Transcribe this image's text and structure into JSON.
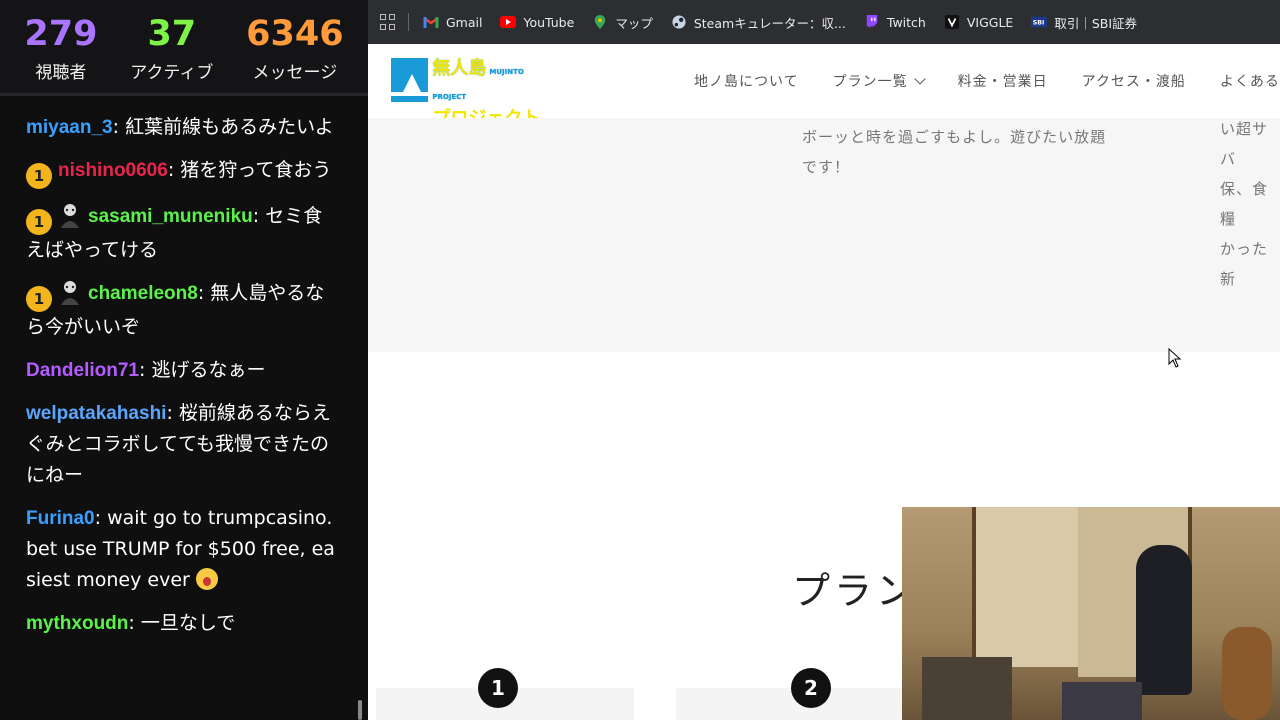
{
  "chat": {
    "stats": [
      {
        "value": "279",
        "label": "視聴者",
        "color": "#a974ff"
      },
      {
        "value": "37",
        "label": "アクティブ",
        "color": "#7ff24a"
      },
      {
        "value": "6346",
        "label": "メッセージ",
        "color": "#ff9b3a"
      }
    ],
    "messages": [
      {
        "user": "miyaan_3",
        "color": "#3aa0ff",
        "text": "紅葉前線もあるみたいよ",
        "badge": "",
        "avatar": false
      },
      {
        "user": "nishino0606",
        "color": "#e8254b",
        "text": "猪を狩って食おう",
        "badge": "1",
        "avatar": false
      },
      {
        "user": "sasami_muneniku",
        "color": "#5bf24a",
        "text": "セミ食えばやってける",
        "badge": "1",
        "avatar": true
      },
      {
        "user": "chameleon8",
        "color": "#5bf24a",
        "text": "無人島やるなら今がいいぞ",
        "badge": "1",
        "avatar": true
      },
      {
        "user": "Dandelion71",
        "color": "#b45cff",
        "text": "逃げるなぁー",
        "badge": "",
        "avatar": false
      },
      {
        "user": "welpatakahashi",
        "color": "#5aa6ff",
        "text": "桜前線あるならえぐみとコラボしてても我慢できたのにねー",
        "badge": "",
        "avatar": false
      },
      {
        "user": "Furina0",
        "color": "#3aa0ff",
        "text": "wait go to trumpcasino.bet use TRUMP for $500 free, easiest money ever",
        "badge": "",
        "avatar": false,
        "emoji": "scream-emoji"
      },
      {
        "user": "mythxoudn",
        "color": "#5bf24a",
        "text": "一旦なしで",
        "badge": "",
        "avatar": false
      }
    ]
  },
  "bookmarks": [
    {
      "label": "Gmail",
      "icon": "gmail-icon",
      "color": "#ea4335"
    },
    {
      "label": "YouTube",
      "icon": "youtube-icon",
      "color": "#ff0000"
    },
    {
      "label": "マップ",
      "icon": "maps-icon",
      "color": "#34a853"
    },
    {
      "label": "Steamキュレーター：収...",
      "icon": "steam-icon",
      "color": "#c7d5e0"
    },
    {
      "label": "Twitch",
      "icon": "twitch-icon",
      "color": "#9146ff"
    },
    {
      "label": "VIGGLE",
      "icon": "viggle-icon",
      "color": "#ffffff"
    },
    {
      "label": "取引｜SBI証券",
      "icon": "sbi-icon",
      "color": "#1d3a8a"
    }
  ],
  "site": {
    "logo": {
      "line1": "無人島",
      "tag": "MUJINTO PROJECT",
      "line2": "プロジェクト"
    },
    "nav": [
      {
        "label": "地ノ島について",
        "dropdown": false
      },
      {
        "label": "プラン一覧",
        "dropdown": true
      },
      {
        "label": "料金・営業日",
        "dropdown": false
      },
      {
        "label": "アクセス・渡船",
        "dropdown": false
      },
      {
        "label": "よくある",
        "dropdown": false
      }
    ],
    "band_text_left": [
      "ボーッと時を過ごすもよし。遊びたい放題",
      "です！"
    ],
    "band_text_right": [
      "い超サバ",
      "保、食糧",
      "かった新"
    ],
    "plan_heading": "プラン",
    "plan_numbers": [
      "1",
      "2"
    ]
  }
}
